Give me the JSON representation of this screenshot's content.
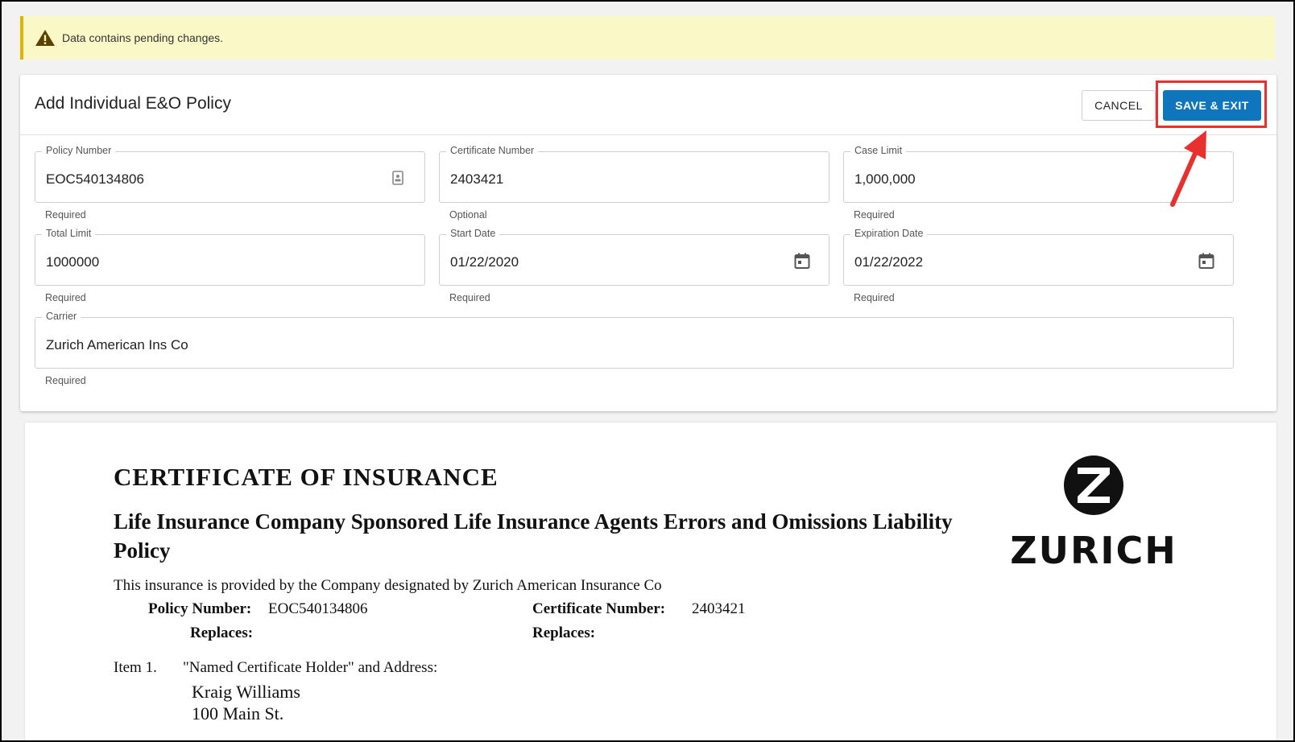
{
  "banner": {
    "message": "Data contains pending changes.",
    "icon": "warning-icon"
  },
  "card": {
    "title": "Add Individual E&O Policy",
    "cancel_label": "CANCEL",
    "save_label": "SAVE & EXIT"
  },
  "fields": {
    "policy_number": {
      "label": "Policy Number",
      "value": "EOC540134806",
      "helper": "Required",
      "icon": "contact-card-icon"
    },
    "certificate_number": {
      "label": "Certificate Number",
      "value": "2403421",
      "helper": "Optional"
    },
    "case_limit": {
      "label": "Case Limit",
      "value": "1,000,000",
      "helper": "Required"
    },
    "total_limit": {
      "label": "Total Limit",
      "value": "1000000",
      "helper": "Required"
    },
    "start_date": {
      "label": "Start Date",
      "value": "01/22/2020",
      "helper": "Required",
      "icon": "calendar-icon"
    },
    "expiration_date": {
      "label": "Expiration Date",
      "value": "01/22/2022",
      "helper": "Required",
      "icon": "calendar-icon"
    },
    "carrier": {
      "label": "Carrier",
      "value": "Zurich American Ins Co",
      "helper": "Required"
    }
  },
  "document": {
    "title": "CERTIFICATE OF INSURANCE",
    "subtitle": "Life Insurance Company Sponsored Life Insurance Agents Errors and Omissions Liability Policy",
    "provided_by": "This insurance is provided by the Company designated by Zurich American Insurance Co",
    "policy_number_label": "Policy Number:",
    "policy_number_value": "EOC540134806",
    "certificate_number_label": "Certificate Number:",
    "certificate_number_value": "2403421",
    "replaces_label": "Replaces:",
    "item_label": "Item 1.",
    "item_text": "\"Named Certificate Holder\" and Address:",
    "holder_name": "Kraig Williams",
    "holder_address": "100 Main St.",
    "logo_text": "ZURICH"
  },
  "colors": {
    "primary": "#0f75bc",
    "highlight": "#e8312f",
    "banner_bg": "#fbf8c8"
  }
}
